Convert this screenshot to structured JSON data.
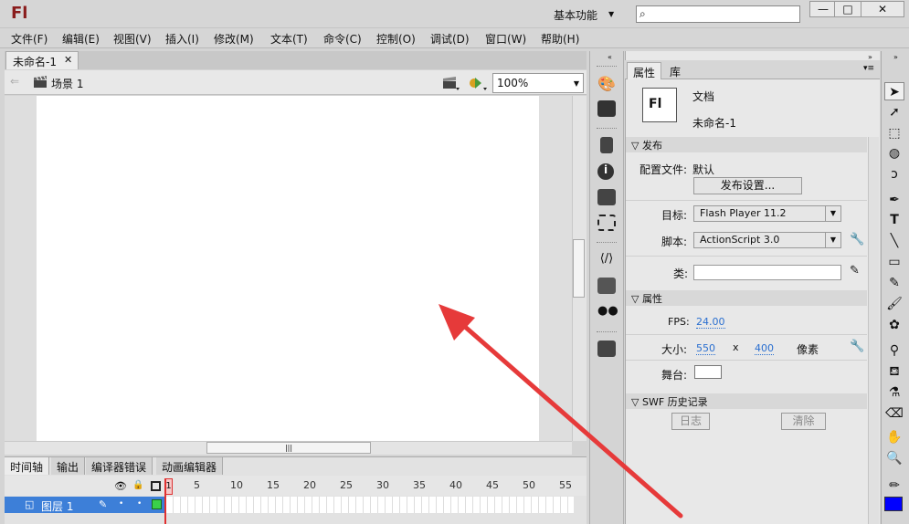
{
  "app": {
    "logo": "Fl",
    "workspace": "基本功能",
    "search_placeholder": ""
  },
  "window_buttons": {
    "minimize": "—",
    "maximize": "□",
    "close": "✕"
  },
  "menu": [
    "文件(F)",
    "编辑(E)",
    "视图(V)",
    "插入(I)",
    "修改(M)",
    "文本(T)",
    "命令(C)",
    "控制(O)",
    "调试(D)",
    "窗口(W)",
    "帮助(H)"
  ],
  "document": {
    "tab_name": "未命名-1",
    "scene": "场景 1",
    "zoom": "100%"
  },
  "timeline": {
    "tabs": [
      "时间轴",
      "输出",
      "编译器错误",
      "动画编辑器"
    ],
    "frame_numbers": [
      "1",
      "5",
      "10",
      "15",
      "20",
      "25",
      "30",
      "35",
      "40",
      "45",
      "50",
      "55"
    ],
    "layer_name": "图层 1",
    "current_frame": "1"
  },
  "properties": {
    "tabs": [
      "属性",
      "库"
    ],
    "doc_icon": "Fl",
    "doc_type": "文档",
    "doc_name": "未命名-1",
    "publish_section": "发布",
    "profile_label": "配置文件:",
    "profile_value": "默认",
    "publish_settings_button": "发布设置...",
    "target_label": "目标:",
    "target_value": "Flash Player 11.2",
    "script_label": "脚本:",
    "script_value": "ActionScript 3.0",
    "class_label": "类:",
    "class_value": "",
    "props_section": "属性",
    "fps_label": "FPS:",
    "fps_value": "24.00",
    "size_label": "大小:",
    "width": "550",
    "size_x": "x",
    "height": "400",
    "unit": "像素",
    "stage_label": "舞台:",
    "stage_color": "#ffffff",
    "swf_section": "SWF 历史记录",
    "log_button": "日志",
    "clear_button": "清除"
  },
  "colors": {
    "accent": "#3d7fd8",
    "annotation_arrow": "#e63a3a",
    "stroke_swatch": "#000000",
    "fill_swatch": "#0000ff"
  }
}
